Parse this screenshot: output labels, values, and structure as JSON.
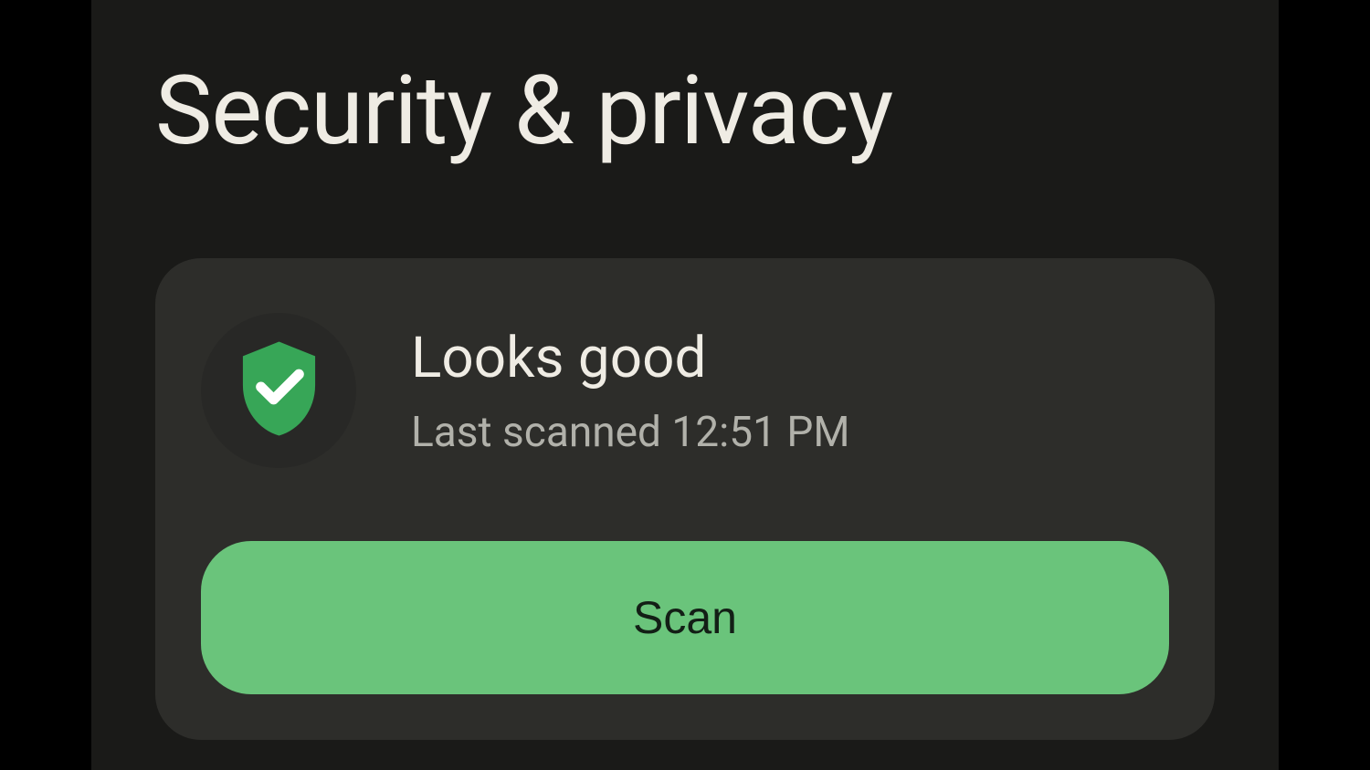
{
  "page": {
    "title": "Security & privacy"
  },
  "status_card": {
    "title": "Looks good",
    "subtitle": "Last scanned 12:51 PM",
    "scan_button_label": "Scan"
  }
}
